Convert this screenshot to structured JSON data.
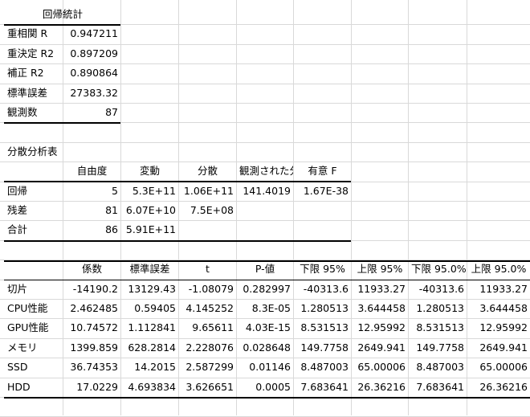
{
  "regression_stats": {
    "title": "回帰統計",
    "rows": [
      {
        "label": "重相関 R",
        "value": "0.947211"
      },
      {
        "label": "重決定 R2",
        "value": "0.897209"
      },
      {
        "label": "補正 R2",
        "value": "0.890864"
      },
      {
        "label": "標準誤差",
        "value": "27383.32"
      },
      {
        "label": "観測数",
        "value": "87"
      }
    ]
  },
  "anova": {
    "title": "分散分析表",
    "headers": [
      "",
      "自由度",
      "変動",
      "分散",
      "観測された分散比",
      "有意 F"
    ],
    "rows": [
      [
        "回帰",
        "5",
        "5.3E+11",
        "1.06E+11",
        "141.4019",
        "1.67E-38"
      ],
      [
        "残差",
        "81",
        "6.07E+10",
        "7.5E+08",
        "",
        ""
      ],
      [
        "合計",
        "86",
        "5.91E+11",
        "",
        "",
        ""
      ]
    ]
  },
  "coefficients": {
    "headers": [
      "",
      "係数",
      "標準誤差",
      "t",
      "P-値",
      "下限 95%",
      "上限 95%",
      "下限 95.0%",
      "上限 95.0%"
    ],
    "rows": [
      [
        "切片",
        "-14190.2",
        "13129.43",
        "-1.08079",
        "0.282997",
        "-40313.6",
        "11933.27",
        "-40313.6",
        "11933.27"
      ],
      [
        "CPU性能",
        "2.462485",
        "0.59405",
        "4.145252",
        "8.3E-05",
        "1.280513",
        "3.644458",
        "1.280513",
        "3.644458"
      ],
      [
        "GPU性能",
        "10.74572",
        "1.112841",
        "9.65611",
        "4.03E-15",
        "8.531513",
        "12.95992",
        "8.531513",
        "12.95992"
      ],
      [
        "メモリ",
        "1399.859",
        "628.2814",
        "2.228076",
        "0.028648",
        "149.7758",
        "2649.941",
        "149.7758",
        "2649.941"
      ],
      [
        "SSD",
        "36.74353",
        "14.2015",
        "2.587299",
        "0.01146",
        "8.487003",
        "65.00006",
        "8.487003",
        "65.00006"
      ],
      [
        "HDD",
        "17.0229",
        "4.693834",
        "3.626651",
        "0.0005",
        "7.683641",
        "26.36216",
        "7.683641",
        "26.36216"
      ]
    ]
  }
}
